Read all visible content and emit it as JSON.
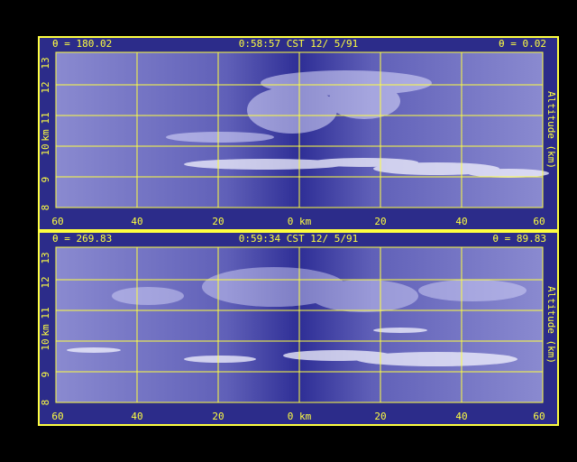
{
  "panels": [
    {
      "theta_left": "θ = 180.02",
      "timestamp": "0:58:57 CST 12/ 5/91",
      "theta_right": "θ = 0.02"
    },
    {
      "theta_left": "θ = 269.83",
      "timestamp": "0:59:34 CST 12/ 5/91",
      "theta_right": "θ = 89.83"
    }
  ],
  "y_axis": {
    "label": "km",
    "ticks": [
      "13",
      "12",
      "11",
      "10",
      "9",
      "8"
    ]
  },
  "x_axis": {
    "ticks": [
      "60",
      "40",
      "20",
      "0 km",
      "20",
      "40",
      "60"
    ]
  },
  "right_axis_label": "Altitude (km)",
  "colors": {
    "frame": "#ffff40",
    "background": "#000000",
    "plot_base": "#3a3aa0"
  }
}
